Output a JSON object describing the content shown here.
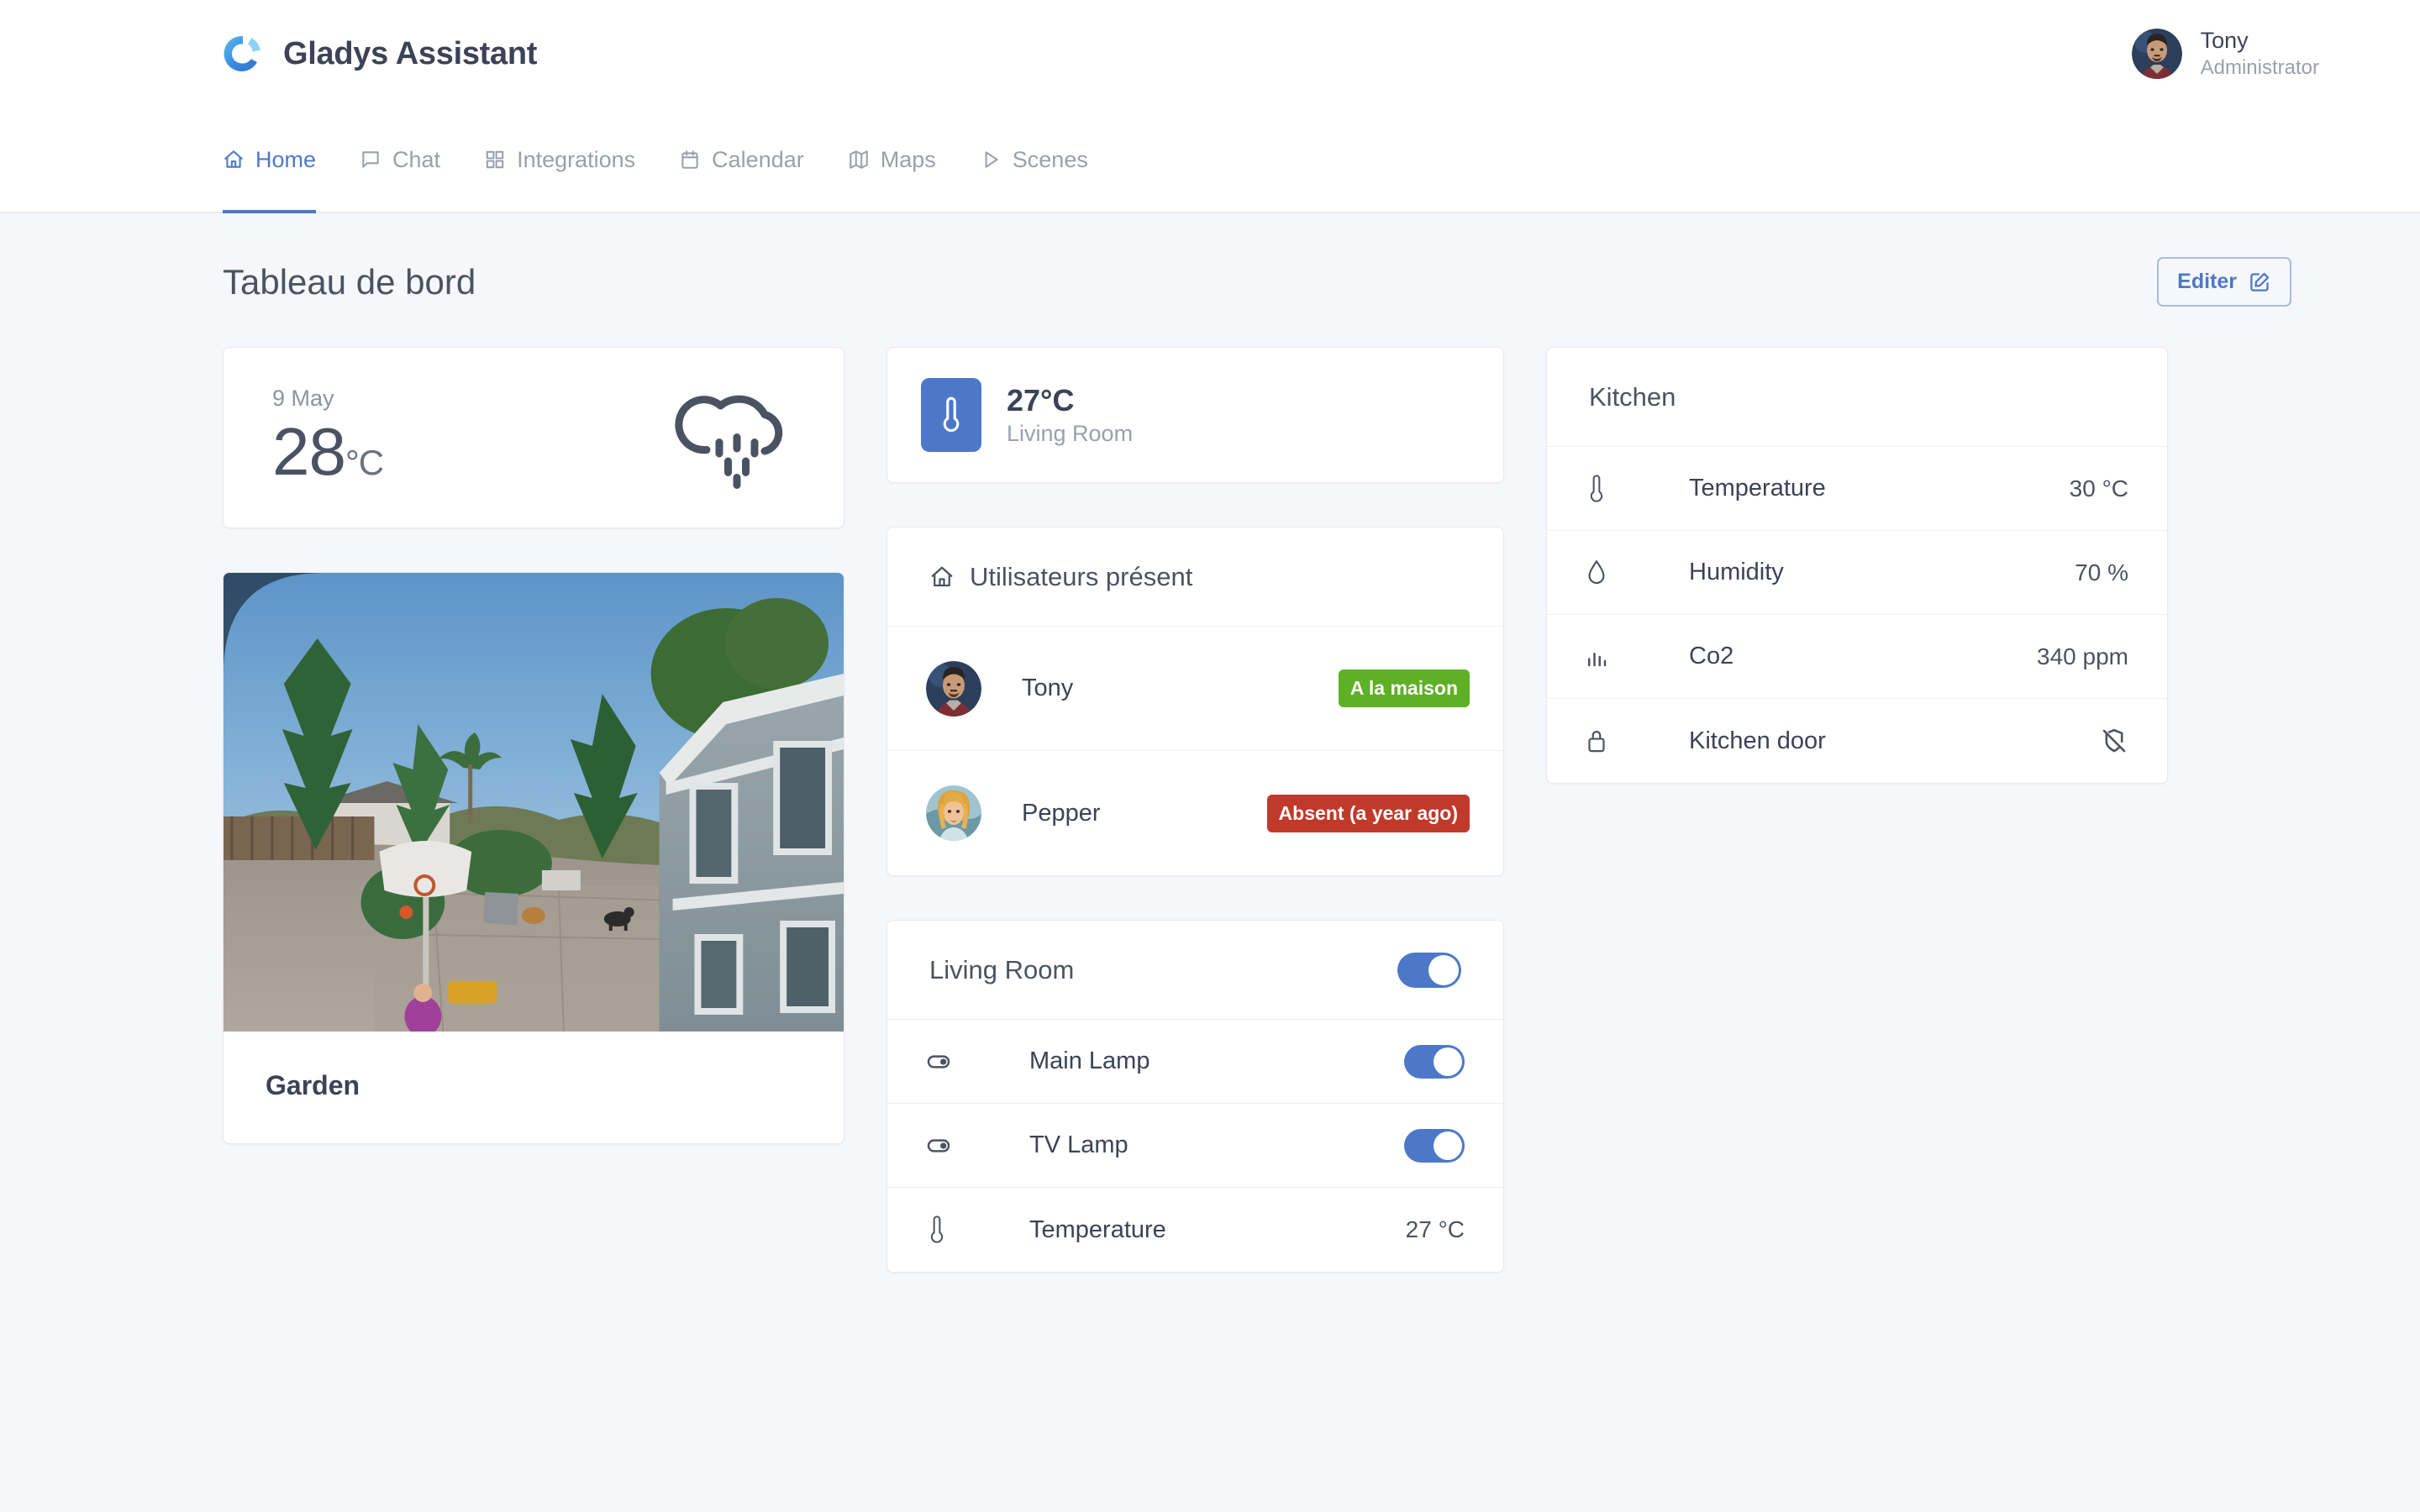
{
  "header": {
    "brand": "Gladys Assistant",
    "logo_icon": "gladys-ring-logo",
    "user": {
      "name": "Tony",
      "role": "Administrator",
      "avatar_icon": "user-avatar-tony"
    }
  },
  "nav": {
    "items": [
      {
        "label": "Home",
        "icon": "home-icon",
        "active": true
      },
      {
        "label": "Chat",
        "icon": "chat-bubble-icon",
        "active": false
      },
      {
        "label": "Integrations",
        "icon": "grid-icon",
        "active": false
      },
      {
        "label": "Calendar",
        "icon": "calendar-icon",
        "active": false
      },
      {
        "label": "Maps",
        "icon": "map-icon",
        "active": false
      },
      {
        "label": "Scenes",
        "icon": "play-triangle-icon",
        "active": false
      }
    ]
  },
  "page": {
    "title": "Tableau de bord",
    "edit_button": {
      "label": "Editer",
      "icon": "edit-pencil-square-icon"
    }
  },
  "weather": {
    "date": "9 May",
    "temperature": "28",
    "unit": "°C",
    "icon": "cloud-rain-icon"
  },
  "camera": {
    "name": "Garden",
    "image_alt": "garden-camera-live-view"
  },
  "sensor_single": {
    "value": "27°C",
    "room": "Living Room",
    "icon": "thermometer-icon"
  },
  "users_card": {
    "title": "Utilisateurs présent",
    "icon": "home-icon",
    "users": [
      {
        "name": "Tony",
        "status": "A la maison",
        "status_type": "home",
        "avatar_icon": "user-avatar-tony"
      },
      {
        "name": "Pepper",
        "status": "Absent (a year ago)",
        "status_type": "away",
        "avatar_icon": "user-avatar-pepper"
      }
    ]
  },
  "living_room_card": {
    "title": "Living Room",
    "master_toggle": "on",
    "rows": [
      {
        "label": "Main Lamp",
        "icon": "light-toggle-icon",
        "control": "toggle",
        "state": "on",
        "value": ""
      },
      {
        "label": "TV Lamp",
        "icon": "light-toggle-icon",
        "control": "toggle",
        "state": "on",
        "value": ""
      },
      {
        "label": "Temperature",
        "icon": "thermometer-icon",
        "control": "value",
        "state": "",
        "value": "27 °C"
      }
    ]
  },
  "kitchen_card": {
    "title": "Kitchen",
    "rows": [
      {
        "label": "Temperature",
        "icon": "thermometer-icon",
        "control": "value",
        "value": "30 °C"
      },
      {
        "label": "Humidity",
        "icon": "droplet-icon",
        "control": "value",
        "value": "70 %"
      },
      {
        "label": "Co2",
        "icon": "bar-chart-icon",
        "control": "value",
        "value": "340 ppm"
      },
      {
        "label": "Kitchen door",
        "icon": "lock-icon",
        "control": "icon",
        "value": "",
        "state_icon": "shield-off-icon"
      }
    ]
  },
  "colors": {
    "accent": "#4d78c7",
    "page_background": "#f5f7fb",
    "card_background": "#ffffff",
    "badge_home": "#5eb025",
    "badge_away": "#c0392b",
    "text_primary": "#3c4257",
    "text_muted": "#9aa0ab"
  }
}
